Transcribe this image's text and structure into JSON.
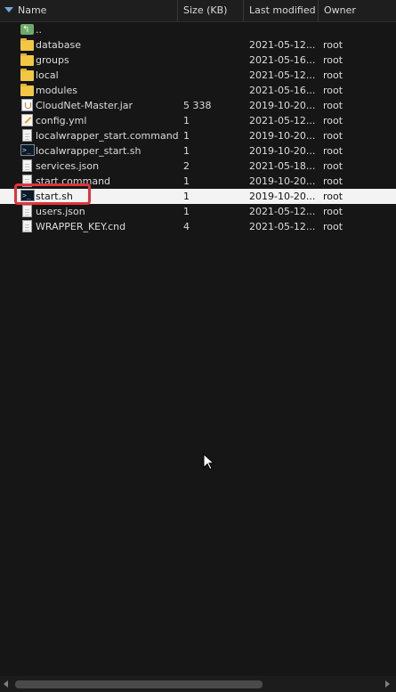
{
  "columns": {
    "name": "Name",
    "size": "Size (KB)",
    "modified": "Last modified",
    "owner": "Owner"
  },
  "rows": [
    {
      "name": "..",
      "size": "",
      "modified": "",
      "owner": "",
      "icon": "up-folder-icon"
    },
    {
      "name": "database",
      "size": "",
      "modified": "2021-05-12...",
      "owner": "root",
      "icon": "folder-icon"
    },
    {
      "name": "groups",
      "size": "",
      "modified": "2021-05-16...",
      "owner": "root",
      "icon": "folder-icon"
    },
    {
      "name": "local",
      "size": "",
      "modified": "2021-05-12...",
      "owner": "root",
      "icon": "folder-icon"
    },
    {
      "name": "modules",
      "size": "",
      "modified": "2021-05-16...",
      "owner": "root",
      "icon": "folder-icon"
    },
    {
      "name": "CloudNet-Master.jar",
      "size": "5 338",
      "modified": "2019-10-20...",
      "owner": "root",
      "icon": "jar-file-icon"
    },
    {
      "name": "config.yml",
      "size": "1",
      "modified": "2021-05-12...",
      "owner": "root",
      "icon": "yml-file-icon"
    },
    {
      "name": "localwrapper_start.command",
      "size": "1",
      "modified": "2019-10-20...",
      "owner": "root",
      "icon": "file-icon"
    },
    {
      "name": "localwrapper_start.sh",
      "size": "1",
      "modified": "2019-10-20...",
      "owner": "root",
      "icon": "terminal-file-icon"
    },
    {
      "name": "services.json",
      "size": "2",
      "modified": "2021-05-18...",
      "owner": "root",
      "icon": "file-icon"
    },
    {
      "name": "start.command",
      "size": "1",
      "modified": "2019-10-20...",
      "owner": "root",
      "icon": "file-icon"
    },
    {
      "name": "start.sh",
      "size": "1",
      "modified": "2019-10-20...",
      "owner": "root",
      "icon": "terminal-file-icon",
      "selected": true
    },
    {
      "name": "users.json",
      "size": "1",
      "modified": "2021-05-12...",
      "owner": "root",
      "icon": "file-icon"
    },
    {
      "name": "WRAPPER_KEY.cnd",
      "size": "4",
      "modified": "2021-05-12...",
      "owner": "root",
      "icon": "file-icon"
    }
  ],
  "colors": {
    "background": "#161616",
    "selection": "#f3f3f3",
    "highlight_box": "#e0343a",
    "folder": "#f2c744"
  }
}
